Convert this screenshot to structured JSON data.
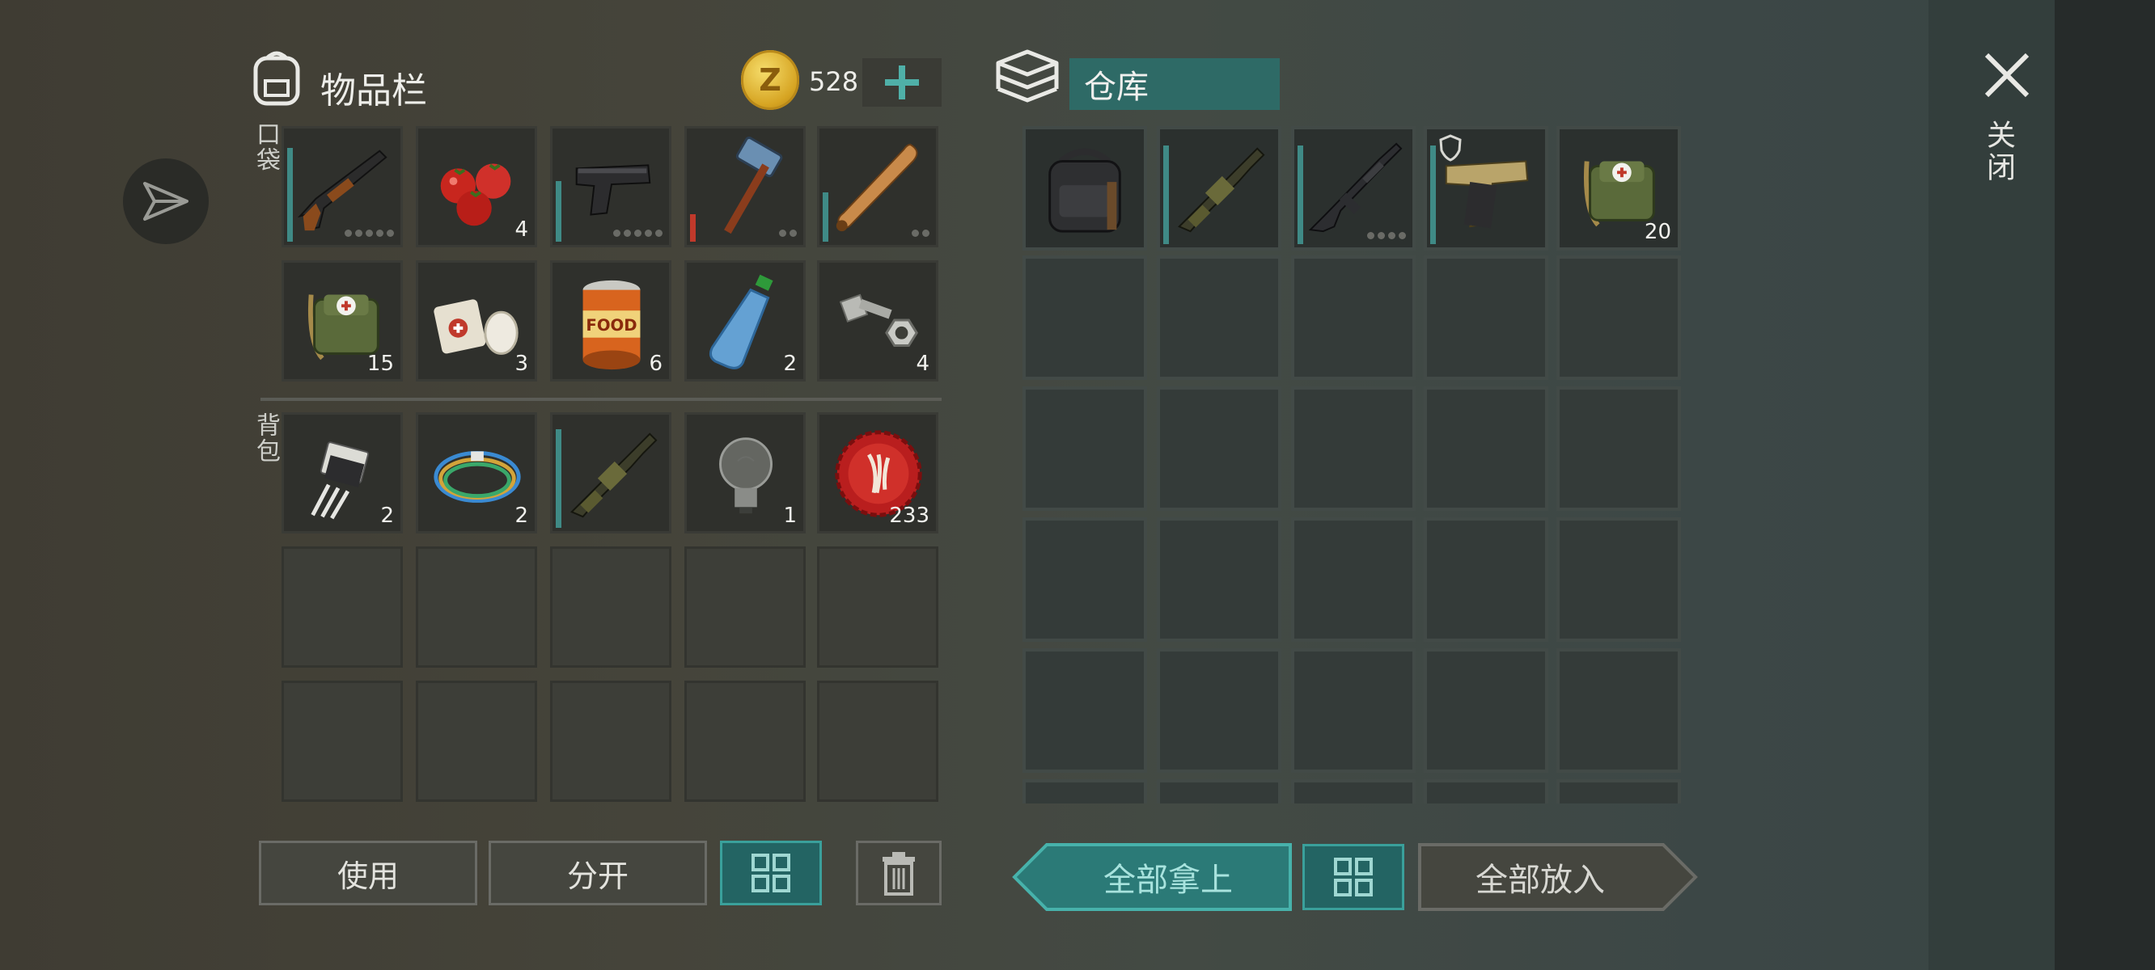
{
  "inventory": {
    "title": "物品栏",
    "coins": "528",
    "pocket_label": "口袋",
    "backpack_label": "背包",
    "pocket_items": [
      {
        "icon": "shotgun-icon",
        "count": "",
        "durability": 0.85,
        "dots": 5
      },
      {
        "icon": "tomatoes-icon",
        "count": "4"
      },
      {
        "icon": "pistol-icon",
        "count": "",
        "durability": 0.55,
        "dots": 5
      },
      {
        "icon": "sledgehammer-icon",
        "count": "",
        "durability": 0.25,
        "red": true,
        "dots": 2
      },
      {
        "icon": "baseball-bat-icon",
        "count": "",
        "durability": 0.45,
        "dots": 2
      },
      {
        "icon": "medkit-icon",
        "count": "15"
      },
      {
        "icon": "bandage-icon",
        "count": "3"
      },
      {
        "icon": "canned-food-icon",
        "count": "6"
      },
      {
        "icon": "water-bottle-icon",
        "count": "2"
      },
      {
        "icon": "bolt-nut-icon",
        "count": "4"
      }
    ],
    "backpack_items": [
      {
        "icon": "transistor-icon",
        "count": "2"
      },
      {
        "icon": "wires-icon",
        "count": "2"
      },
      {
        "icon": "grenade-launcher-icon",
        "count": "",
        "durability": 0.9
      },
      {
        "icon": "light-bulb-icon",
        "count": "1"
      },
      {
        "icon": "bottle-cap-icon",
        "count": "233"
      }
    ],
    "can_label": "FOOD"
  },
  "warehouse": {
    "title": "仓库",
    "items": [
      {
        "icon": "backpack-icon",
        "count": ""
      },
      {
        "icon": "grenade-launcher-icon",
        "count": "",
        "durability": 0.9
      },
      {
        "icon": "assault-rifle-icon",
        "count": "",
        "durability": 0.9,
        "dots": 4
      },
      {
        "icon": "desert-eagle-icon",
        "count": "",
        "durability": 0.9,
        "badge": true
      },
      {
        "icon": "medkit-icon",
        "count": "20"
      }
    ]
  },
  "buttons": {
    "use": "使用",
    "split": "分开",
    "take_all": "全部拿上",
    "put_all": "全部放入",
    "close": "关闭"
  },
  "colors": {
    "accent": "#2e6a66",
    "accent_border": "#3aa09b",
    "coin": "#d6a422"
  }
}
